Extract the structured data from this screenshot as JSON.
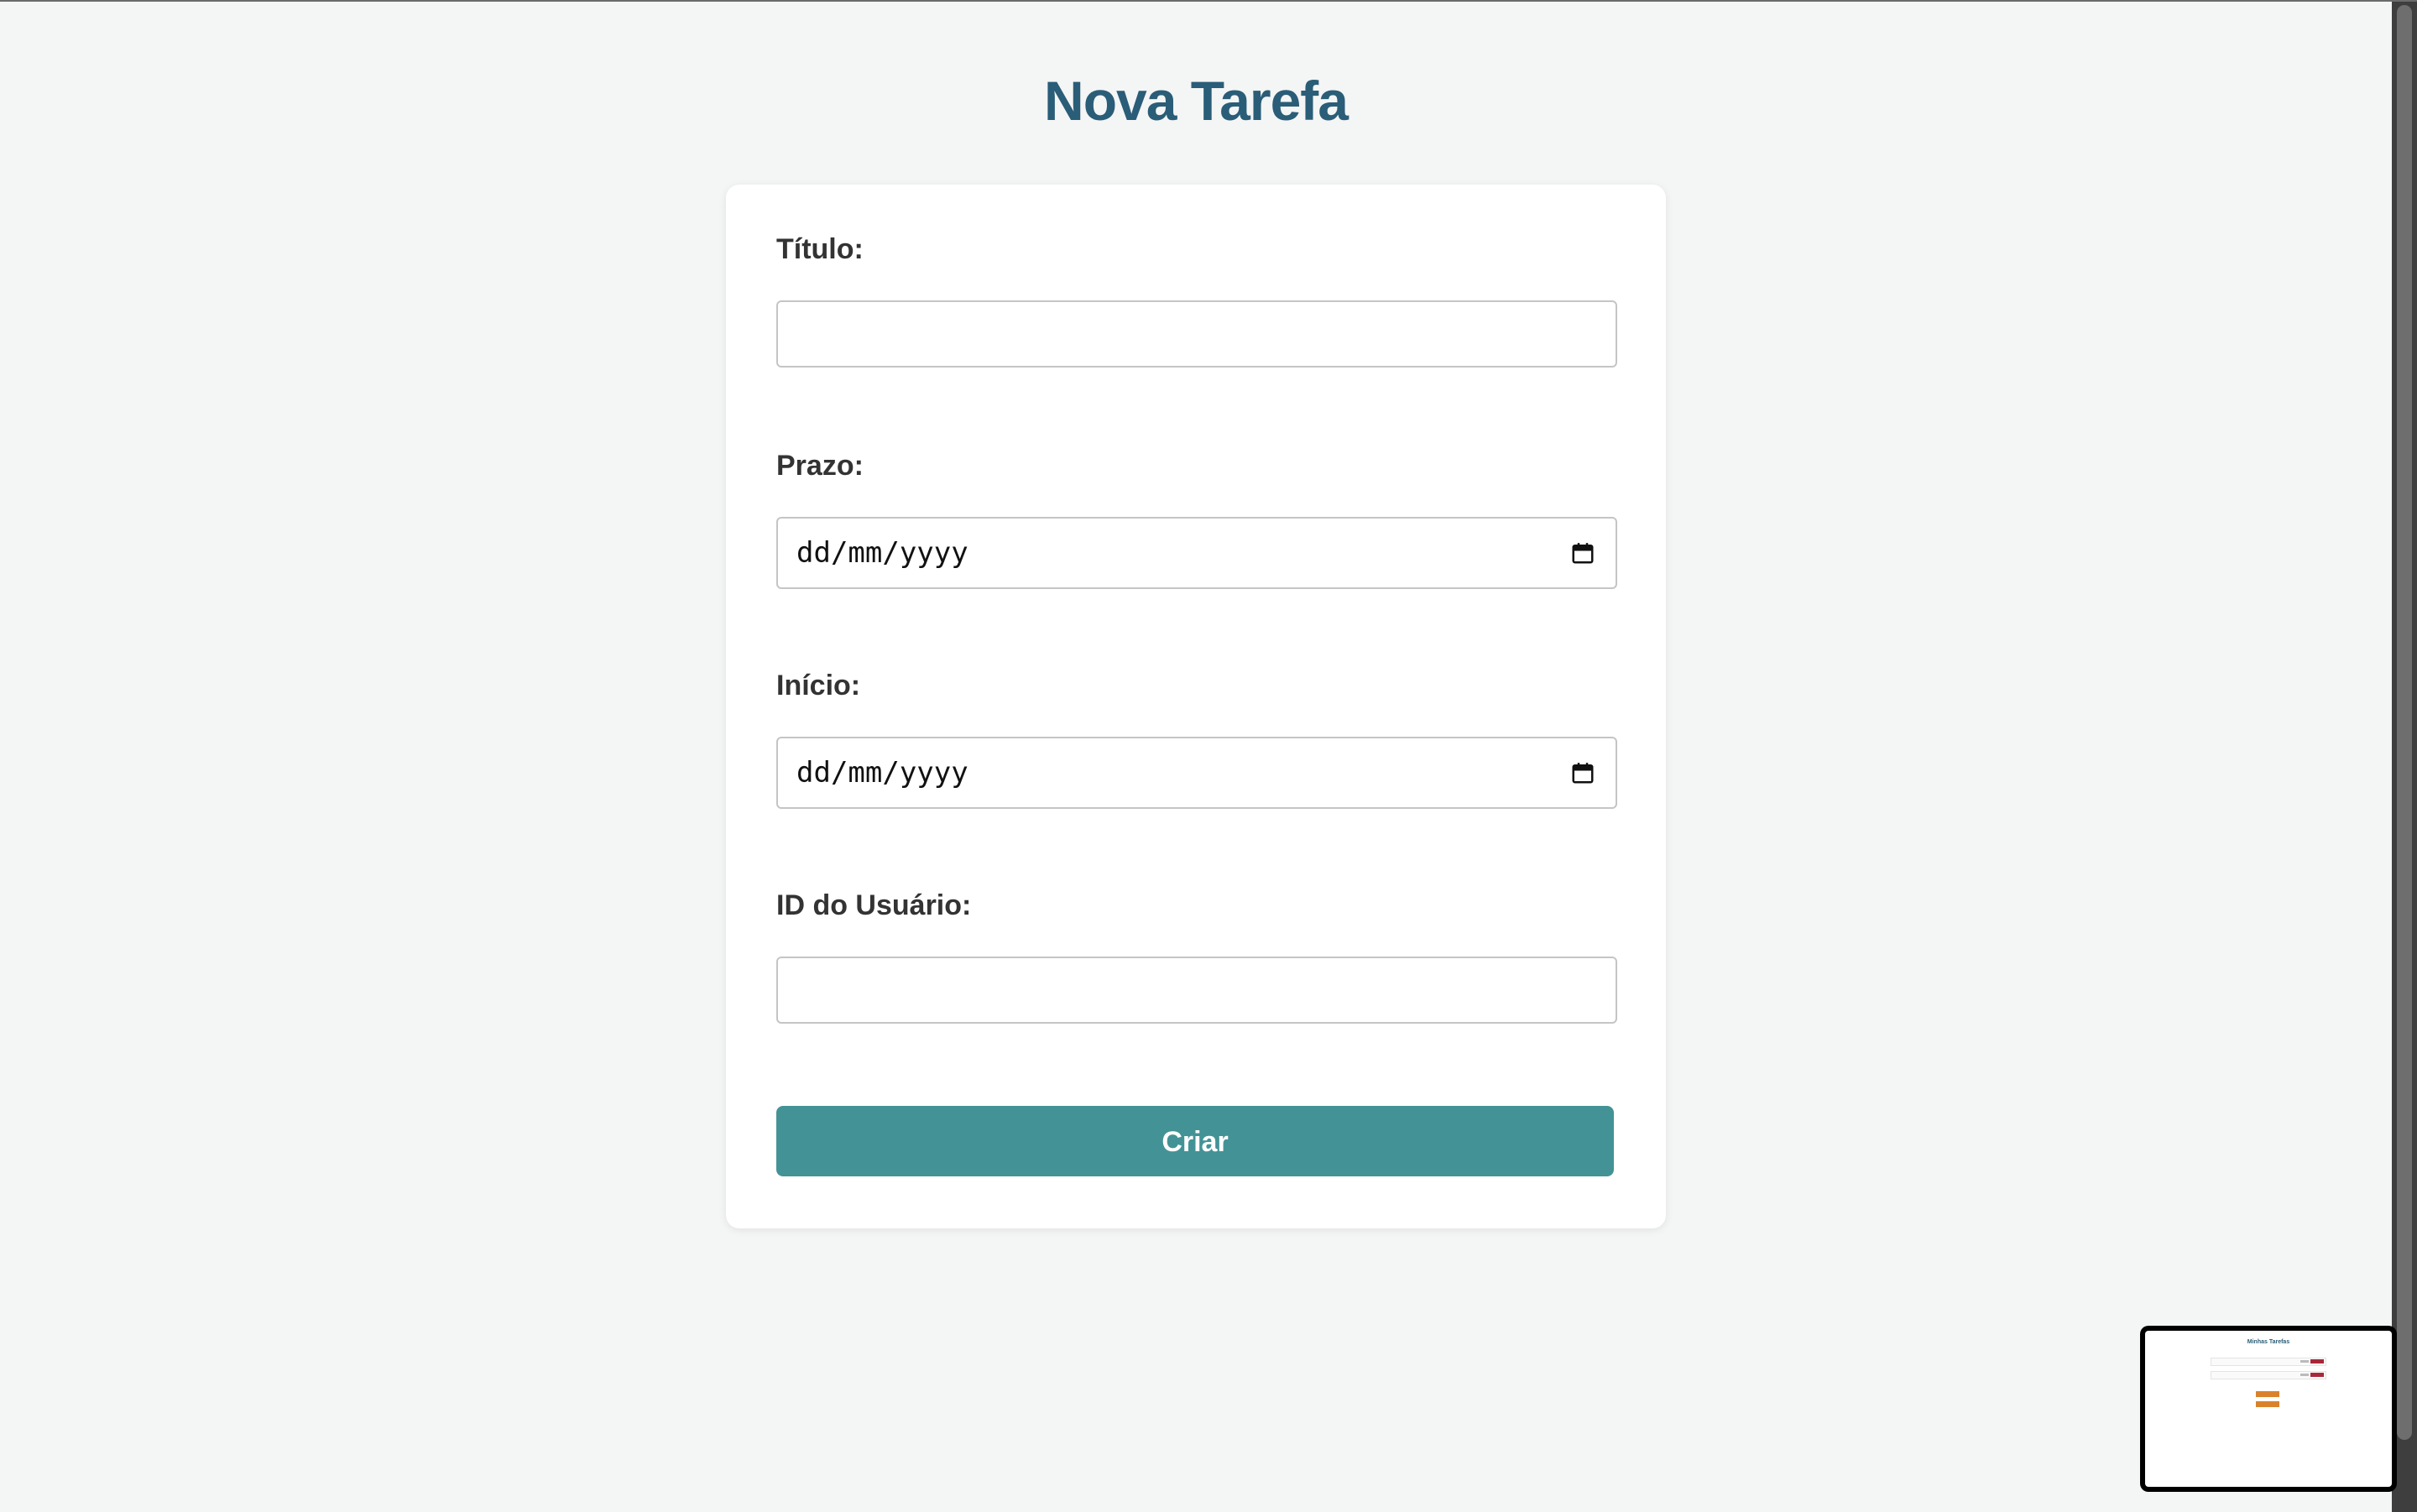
{
  "page": {
    "title": "Nova Tarefa"
  },
  "form": {
    "titulo": {
      "label": "Título:",
      "value": ""
    },
    "prazo": {
      "label": "Prazo:",
      "placeholder": "dd/mm/yyyy"
    },
    "inicio": {
      "label": "Início:",
      "placeholder": "dd/mm/yyyy"
    },
    "usuario": {
      "label": "ID do Usuário:",
      "value": ""
    },
    "submit_label": "Criar"
  },
  "preview": {
    "title": "Minhas Tarefas"
  },
  "colors": {
    "title": "#2a5d77",
    "button": "#439396",
    "background": "#f4f5f5",
    "delete": "#a8283a",
    "accent": "#d9822b"
  }
}
